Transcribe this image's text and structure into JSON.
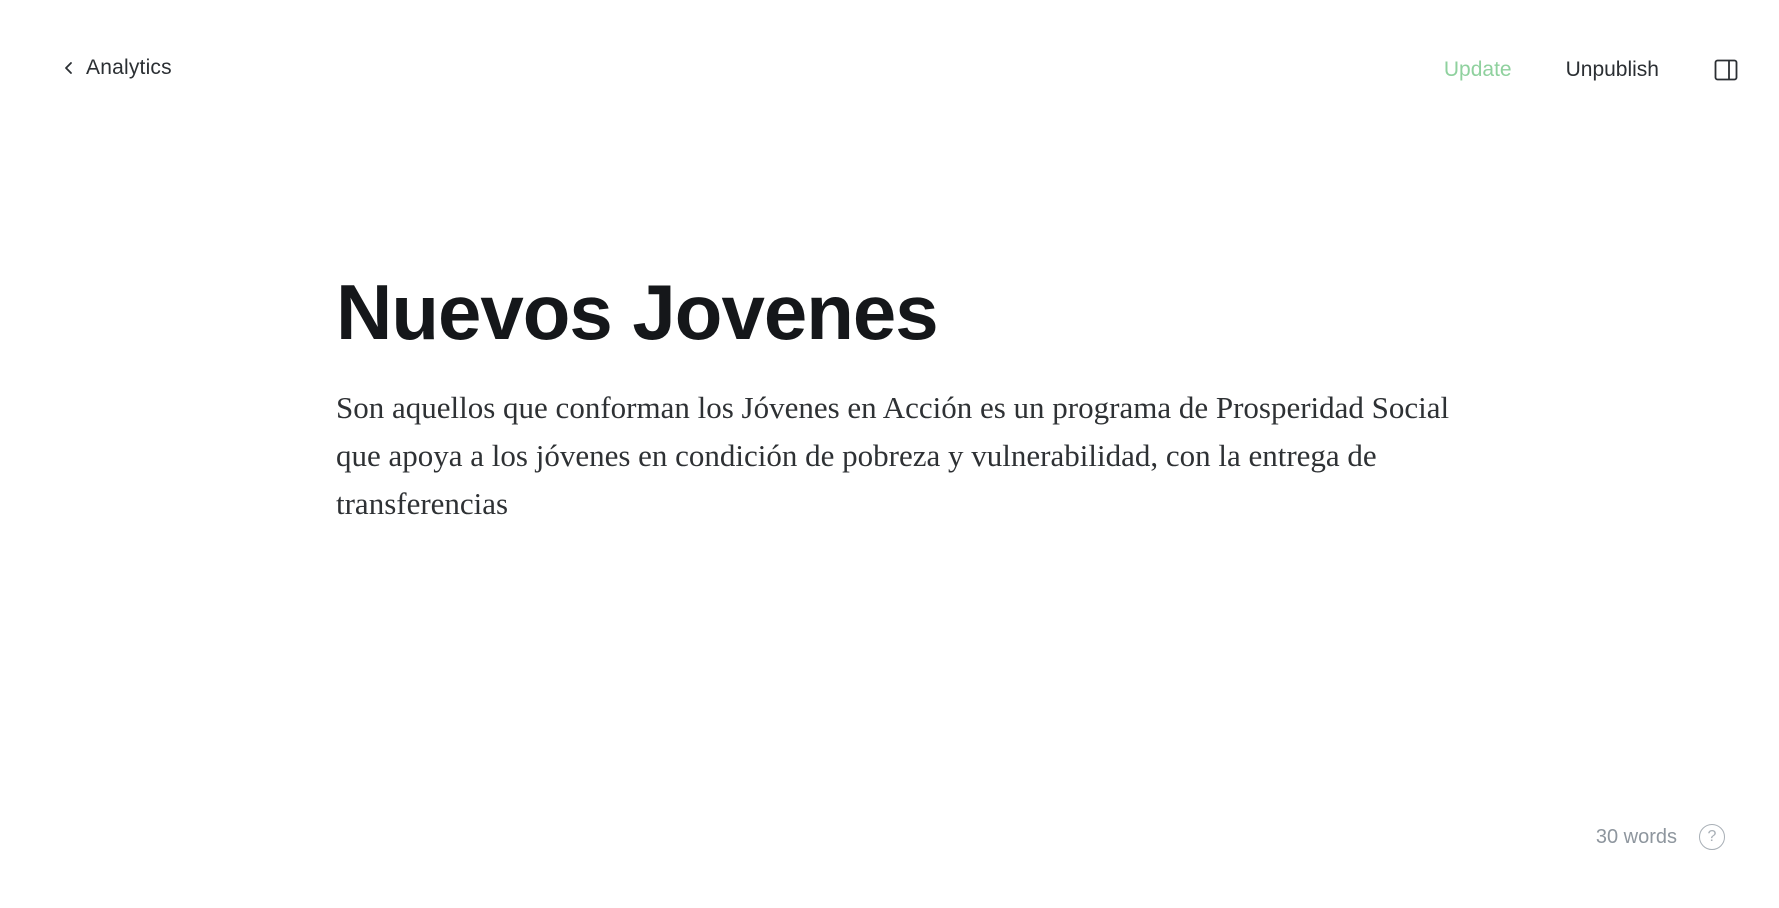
{
  "header": {
    "back_label": "Analytics",
    "back_icon": "chevron-left-icon",
    "update_label": "Update",
    "unpublish_label": "Unpublish",
    "panel_icon": "sidebar-panel-icon",
    "update_color": "#8fd19e"
  },
  "post": {
    "title": "Nuevos Jovenes",
    "body": "Son aquellos que conforman los Jóvenes en Acción es un programa de Prosperidad Social que apoya a los jóvenes en condición de pobreza y vulnerabilidad, con la entrega de transferencias"
  },
  "footer": {
    "word_count": "30 words",
    "help_icon": "help-circle-icon",
    "help_glyph": "?"
  }
}
